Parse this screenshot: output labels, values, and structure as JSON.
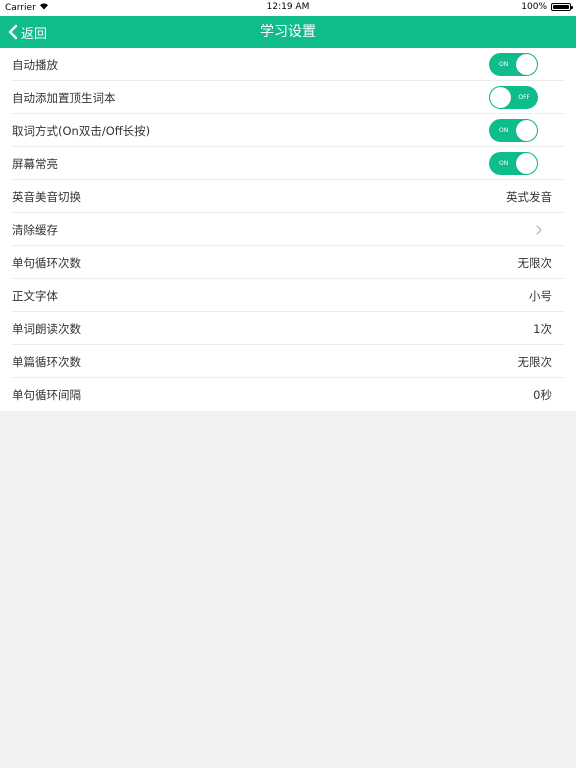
{
  "status": {
    "carrier": "Carrier",
    "time": "12:19 AM",
    "battery": "100%"
  },
  "nav": {
    "back_label": "返回",
    "title": "学习设置"
  },
  "colors": {
    "accent": "#0fbd8c"
  },
  "settings": [
    {
      "label": "自动播放",
      "toggle": "ON"
    },
    {
      "label": "自动添加置顶生词本",
      "toggle": "OFF"
    },
    {
      "label": "取词方式(On双击/Off长按)",
      "toggle": "ON"
    },
    {
      "label": "屏幕常亮",
      "toggle": "ON"
    },
    {
      "label": "英音美音切换",
      "value": "英式发音"
    },
    {
      "label": "清除缓存",
      "icon": "chevron-right-icon"
    },
    {
      "label": "单句循环次数",
      "value": "无限次"
    },
    {
      "label": "正文字体",
      "value": "小号"
    },
    {
      "label": "单词朗读次数",
      "value": "1次"
    },
    {
      "label": "单篇循环次数",
      "value": "无限次"
    },
    {
      "label": "单句循环间隔",
      "value": "0秒"
    }
  ]
}
